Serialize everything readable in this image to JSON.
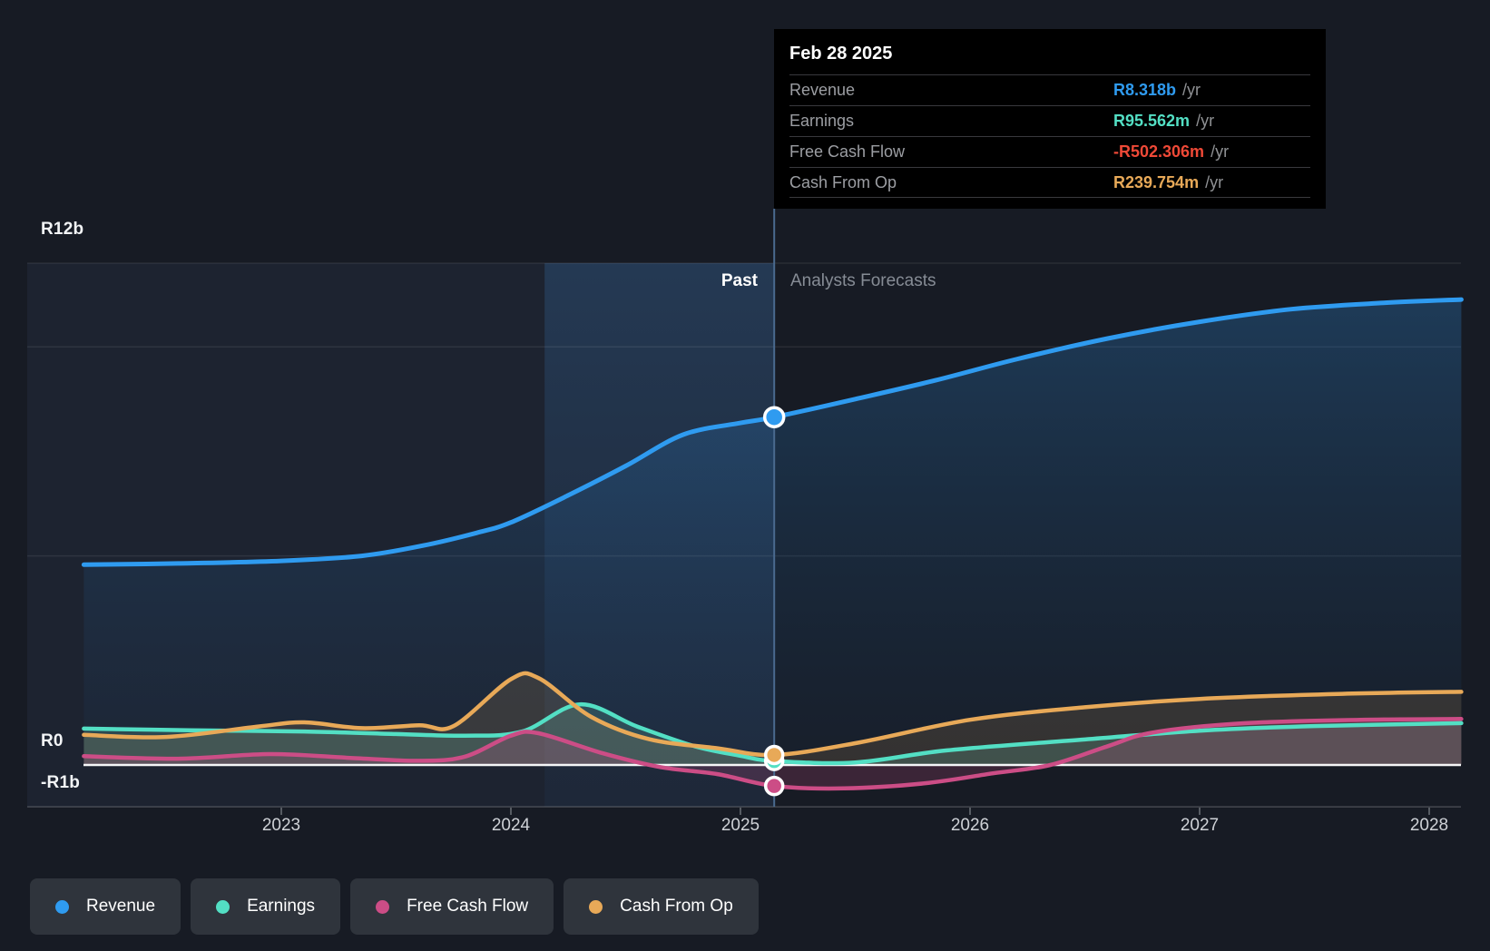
{
  "tooltip": {
    "date": "Feb 28 2025",
    "rows": [
      {
        "label": "Revenue",
        "value": "R8.318b",
        "unit": "/yr",
        "color": "#2f9bf0"
      },
      {
        "label": "Earnings",
        "value": "R95.562m",
        "unit": "/yr",
        "color": "#53dfc4"
      },
      {
        "label": "Free Cash Flow",
        "value": "-R502.306m",
        "unit": "/yr",
        "color": "#ef4937"
      },
      {
        "label": "Cash From Op",
        "value": "R239.754m",
        "unit": "/yr",
        "color": "#e8a958"
      }
    ]
  },
  "annotations": {
    "past": "Past",
    "forecast": "Analysts Forecasts"
  },
  "legend": [
    {
      "label": "Revenue",
      "color": "#2f9bf0"
    },
    {
      "label": "Earnings",
      "color": "#53dfc4"
    },
    {
      "label": "Free Cash Flow",
      "color": "#cc4d86"
    },
    {
      "label": "Cash From Op",
      "color": "#e8a958"
    }
  ],
  "colors": {
    "background": "#171b24",
    "zero_line": "#f5f6f7",
    "divider_line": "#4a6a8f",
    "tooltip_bg": "#000000",
    "legend_pill_bg": "#2f343c"
  },
  "chart_data": {
    "type": "line",
    "values_unit": "R billions (ZAR)",
    "x_axis": {
      "tick_labels": [
        "2023",
        "2024",
        "2025",
        "2026",
        "2027",
        "2028"
      ],
      "ticks": [
        2023,
        2024,
        2025,
        2026,
        2027,
        2028
      ],
      "range": [
        2022.14,
        2028.14
      ]
    },
    "y_axis": {
      "labeled_ticks": [
        {
          "label": "R12b",
          "value": 12
        },
        {
          "label": "R0",
          "value": 0
        },
        {
          "label": "-R1b",
          "value": -1
        }
      ],
      "gridline_values": [
        12,
        10,
        5,
        -1
      ],
      "range": [
        -1.3,
        12.3
      ]
    },
    "divider": {
      "t": 2025.147,
      "date": "Feb 28 2025",
      "highlight_band_start": 2024.147
    },
    "series": [
      {
        "name": "Revenue",
        "color": "#2f9bf0",
        "stroke": 5,
        "fill": "revenue-gradient",
        "marker_value": 8.318,
        "points": [
          [
            2022.14,
            4.79
          ],
          [
            2022.55,
            4.82
          ],
          [
            2023.0,
            4.88
          ],
          [
            2023.35,
            5.0
          ],
          [
            2023.62,
            5.25
          ],
          [
            2023.85,
            5.55
          ],
          [
            2024.0,
            5.8
          ],
          [
            2024.25,
            6.45
          ],
          [
            2024.5,
            7.15
          ],
          [
            2024.75,
            7.9
          ],
          [
            2025.0,
            8.18
          ],
          [
            2025.147,
            8.318
          ],
          [
            2025.5,
            8.75
          ],
          [
            2025.85,
            9.2
          ],
          [
            2026.2,
            9.7
          ],
          [
            2026.6,
            10.2
          ],
          [
            2027.0,
            10.6
          ],
          [
            2027.4,
            10.9
          ],
          [
            2027.8,
            11.05
          ],
          [
            2028.14,
            11.13
          ]
        ]
      },
      {
        "name": "Earnings",
        "color": "#53dfc4",
        "stroke": 4.5,
        "fill": "rgba(110,205,180,0.20)",
        "marker_value": 0.0956,
        "points": [
          [
            2022.14,
            0.87
          ],
          [
            2022.6,
            0.83
          ],
          [
            2023.1,
            0.8
          ],
          [
            2023.5,
            0.74
          ],
          [
            2023.8,
            0.7
          ],
          [
            2024.05,
            0.8
          ],
          [
            2024.3,
            1.45
          ],
          [
            2024.55,
            0.92
          ],
          [
            2024.8,
            0.45
          ],
          [
            2025.0,
            0.22
          ],
          [
            2025.147,
            0.0956
          ],
          [
            2025.5,
            0.06
          ],
          [
            2025.9,
            0.35
          ],
          [
            2026.5,
            0.61
          ],
          [
            2027.0,
            0.82
          ],
          [
            2027.5,
            0.93
          ],
          [
            2028.14,
            1.0
          ]
        ]
      },
      {
        "name": "Cash From Op",
        "color": "#e8a958",
        "stroke": 4.5,
        "fill": "rgba(233,168,90,0.14)",
        "marker_value": 0.2398,
        "points": [
          [
            2022.14,
            0.72
          ],
          [
            2022.5,
            0.67
          ],
          [
            2022.9,
            0.92
          ],
          [
            2023.1,
            1.02
          ],
          [
            2023.35,
            0.88
          ],
          [
            2023.6,
            0.95
          ],
          [
            2023.75,
            0.93
          ],
          [
            2024.0,
            2.05
          ],
          [
            2024.12,
            2.08
          ],
          [
            2024.35,
            1.15
          ],
          [
            2024.6,
            0.62
          ],
          [
            2024.9,
            0.4
          ],
          [
            2025.147,
            0.2398
          ],
          [
            2025.5,
            0.52
          ],
          [
            2026.0,
            1.08
          ],
          [
            2026.5,
            1.38
          ],
          [
            2027.0,
            1.58
          ],
          [
            2027.6,
            1.7
          ],
          [
            2028.14,
            1.75
          ]
        ]
      },
      {
        "name": "Free Cash Flow",
        "color": "#cc4d86",
        "stroke": 4.5,
        "fill": "rgba(205,80,135,0.20)",
        "marker_value": -0.502,
        "points": [
          [
            2022.14,
            0.21
          ],
          [
            2022.55,
            0.15
          ],
          [
            2022.95,
            0.26
          ],
          [
            2023.3,
            0.17
          ],
          [
            2023.6,
            0.1
          ],
          [
            2023.8,
            0.2
          ],
          [
            2024.0,
            0.7
          ],
          [
            2024.12,
            0.76
          ],
          [
            2024.4,
            0.28
          ],
          [
            2024.65,
            -0.05
          ],
          [
            2024.9,
            -0.22
          ],
          [
            2025.147,
            -0.502
          ],
          [
            2025.45,
            -0.56
          ],
          [
            2025.8,
            -0.44
          ],
          [
            2026.1,
            -0.2
          ],
          [
            2026.35,
            0.0
          ],
          [
            2026.6,
            0.45
          ],
          [
            2026.8,
            0.78
          ],
          [
            2027.2,
            1.0
          ],
          [
            2027.7,
            1.08
          ],
          [
            2028.14,
            1.1
          ]
        ]
      }
    ]
  }
}
